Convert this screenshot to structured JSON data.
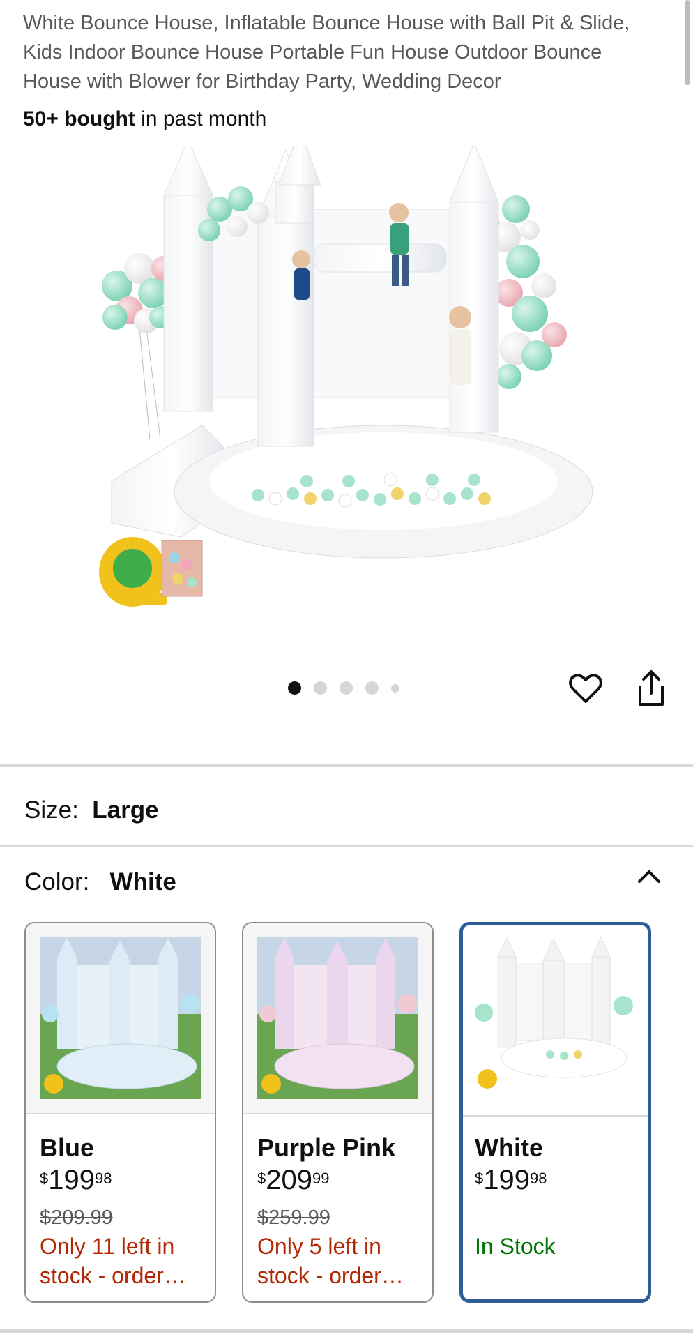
{
  "product": {
    "title": "White Bounce House, Inflatable Bounce House with Ball Pit & Slide, Kids Indoor Bounce House Portable Fun House Outdoor Bounce House with Blower for Birthday Party, Wedding Decor",
    "bought_bold": "50+ bought",
    "bought_rest": " in past month"
  },
  "gallery": {
    "image_count": 5,
    "active_index": 0
  },
  "size": {
    "label": "Size:",
    "value": "Large"
  },
  "color": {
    "label": "Color:",
    "value": "White",
    "options": [
      {
        "name": "Blue",
        "price_symbol": "$",
        "price_whole": "199",
        "price_fraction": "98",
        "was_price": "$209.99",
        "availability": "Only 11 left in stock - order…",
        "tint": "#cfe3f2"
      },
      {
        "name": "Purple Pink",
        "price_symbol": "$",
        "price_whole": "209",
        "price_fraction": "99",
        "was_price": "$259.99",
        "availability": "Only 5 left in stock - order…",
        "tint": "#ead6ec"
      },
      {
        "name": "White",
        "price_symbol": "$",
        "price_whole": "199",
        "price_fraction": "98",
        "was_price": "",
        "availability": "In Stock",
        "tint": "#ffffff",
        "selected": true
      }
    ]
  },
  "colors": {
    "text": "#0f1111",
    "muted": "#565959",
    "low_stock": "#b12704",
    "in_stock": "#007600",
    "selected_border": "#2f5d9a",
    "divider": "#d5d9d9"
  }
}
